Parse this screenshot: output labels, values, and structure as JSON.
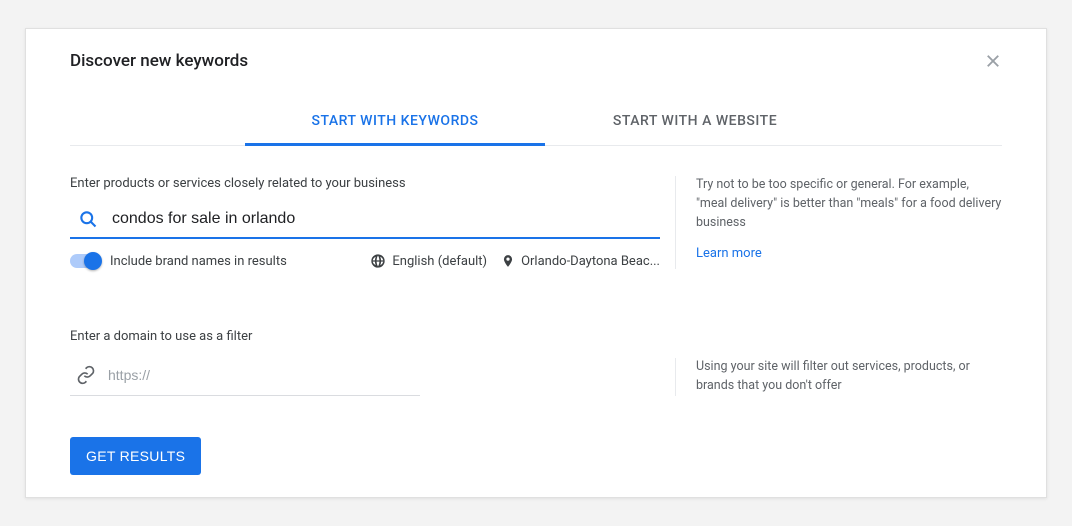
{
  "title": "Discover new keywords",
  "tabs": {
    "keywords": "START WITH KEYWORDS",
    "website": "START WITH A WEBSITE"
  },
  "keyword_section": {
    "label": "Enter products or services closely related to your business",
    "value": "condos for sale in orlando",
    "toggle_label": "Include brand names in results",
    "language": "English (default)",
    "location": "Orlando-Daytona Beac...",
    "hint": "Try not to be too specific or general. For example, \"meal delivery\" is better than \"meals\" for a food delivery business",
    "learn_more": "Learn more"
  },
  "domain_section": {
    "label": "Enter a domain to use as a filter",
    "placeholder": "https://",
    "hint": "Using your site will filter out services, products, or brands that you don't offer"
  },
  "get_results": "GET RESULTS"
}
